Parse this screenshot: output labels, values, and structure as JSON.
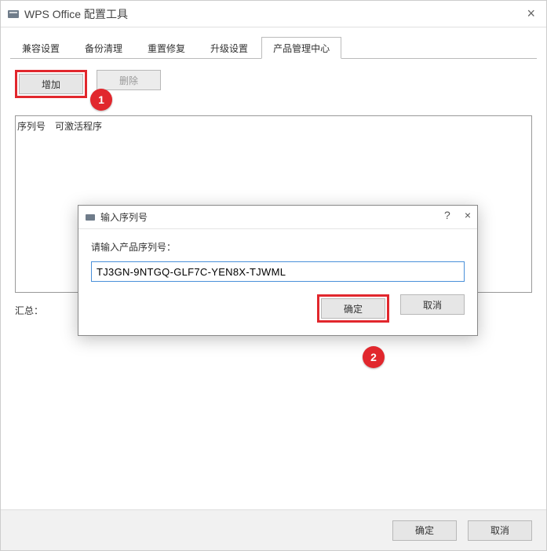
{
  "window": {
    "title": "WPS Office 配置工具"
  },
  "tabs": {
    "items": [
      {
        "label": "兼容设置"
      },
      {
        "label": "备份清理"
      },
      {
        "label": "重置修复"
      },
      {
        "label": "升级设置"
      },
      {
        "label": "产品管理中心"
      }
    ],
    "active_index": 4
  },
  "toolbar": {
    "add_label": "增加",
    "delete_label": "删除"
  },
  "listbox": {
    "col1": "序列号",
    "col2": "可激活程序"
  },
  "summary": {
    "label": "汇总："
  },
  "footer": {
    "ok_label": "确定",
    "cancel_label": "取消"
  },
  "modal": {
    "title": "输入序列号",
    "prompt": "请输入产品序列号：",
    "serial_value": "TJ3GN-9NTGQ-GLF7C-YEN8X-TJWML",
    "ok_label": "确定",
    "cancel_label": "取消",
    "help_symbol": "?",
    "close_symbol": "×"
  },
  "main_close_symbol": "×",
  "markers": {
    "one": "1",
    "two": "2"
  }
}
